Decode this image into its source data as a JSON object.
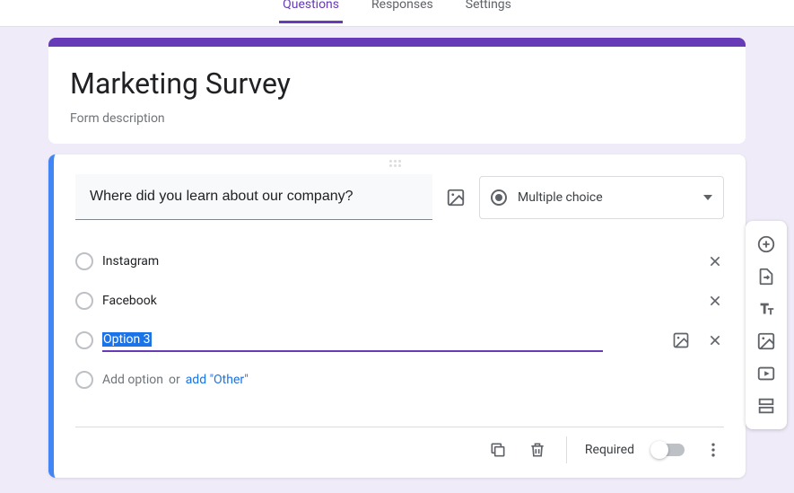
{
  "tabs": {
    "questions": "Questions",
    "responses": "Responses",
    "settings": "Settings"
  },
  "header": {
    "title": "Marketing Survey",
    "description": "Form description"
  },
  "question": {
    "text": "Where did you learn about our company?",
    "type_label": "Multiple choice",
    "options": [
      {
        "label": "Instagram"
      },
      {
        "label": "Facebook"
      },
      {
        "label": "Option 3"
      }
    ],
    "add_option": "Add option",
    "or": "or",
    "add_other": "add \"Other\""
  },
  "footer": {
    "required": "Required"
  }
}
